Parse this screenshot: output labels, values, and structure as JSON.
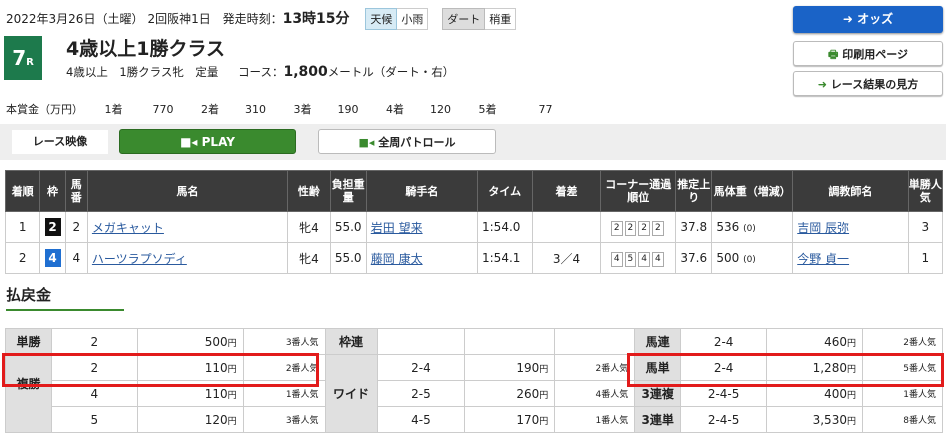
{
  "header": {
    "date": "2022年3月26日（土曜）",
    "meeting": "2回阪神1日",
    "post_time_label": "発走時刻：",
    "post_time": "13時15分",
    "weather_label": "天候",
    "weather_value": "小雨",
    "track_label": "ダート",
    "track_value": "稍重"
  },
  "race": {
    "number": "7",
    "number_suffix": "R",
    "title": "4歳以上1勝クラス",
    "conditions": "4歳以上　1勝クラス牝　定量",
    "course_label": "コース：",
    "distance": "1,800",
    "distance_suffix": "メートル（ダート・右）"
  },
  "buttons": {
    "odds": "オッズ",
    "print": "印刷用ページ",
    "guide": "レース結果の見方"
  },
  "prize": {
    "label": "本賞金（万円）",
    "items": [
      {
        "rank": "1着",
        "value": "770"
      },
      {
        "rank": "2着",
        "value": "310"
      },
      {
        "rank": "3着",
        "value": "190"
      },
      {
        "rank": "4着",
        "value": "120"
      },
      {
        "rank": "5着",
        "value": "77"
      }
    ]
  },
  "video": {
    "label": "レース映像",
    "play": "PLAY",
    "patrol": "全周パトロール"
  },
  "results": {
    "headers": [
      "着順",
      "枠",
      "馬番",
      "馬名",
      "性齢",
      "負担重量",
      "騎手名",
      "タイム",
      "着差",
      "コーナー通過順位",
      "推定上り",
      "馬体重（増減）",
      "調教師名",
      "単勝人気"
    ],
    "rows": [
      {
        "rank": "1",
        "waku": "2",
        "waku_color": "#111111",
        "umaban": "2",
        "horse": "メガキャット",
        "sex_age": "牝4",
        "weight": "55.0",
        "jockey": "岩田 望来",
        "time": "1:54.0",
        "margin": "",
        "corners": [
          "2",
          "2",
          "2",
          "2"
        ],
        "last3f": "37.8",
        "body_weight": "536",
        "body_diff": "(0)",
        "trainer": "吉岡 辰弥",
        "pop": "3"
      },
      {
        "rank": "2",
        "waku": "4",
        "waku_color": "#1f6fd1",
        "umaban": "4",
        "horse": "ハーツラプソディ",
        "sex_age": "牝4",
        "weight": "55.0",
        "jockey": "藤岡 康太",
        "time": "1:54.1",
        "margin": "3／4",
        "corners": [
          "4",
          "5",
          "4",
          "4"
        ],
        "last3f": "37.6",
        "body_weight": "500",
        "body_diff": "(0)",
        "trainer": "今野 貞一",
        "pop": "1"
      }
    ]
  },
  "payout": {
    "title": "払戻金",
    "yen": "円",
    "tansho": {
      "label": "単勝",
      "rows": [
        {
          "num": "2",
          "amount": "500",
          "pop": "3番人気"
        }
      ]
    },
    "fukusho": {
      "label": "複勝",
      "rows": [
        {
          "num": "2",
          "amount": "110",
          "pop": "2番人気"
        },
        {
          "num": "4",
          "amount": "110",
          "pop": "1番人気"
        },
        {
          "num": "5",
          "amount": "120",
          "pop": "3番人気"
        }
      ]
    },
    "wakuren": {
      "label": "枠連"
    },
    "wide": {
      "label": "ワイド",
      "rows": [
        {
          "num": "2-4",
          "amount": "190",
          "pop": "2番人気"
        },
        {
          "num": "2-5",
          "amount": "260",
          "pop": "4番人気"
        },
        {
          "num": "4-5",
          "amount": "170",
          "pop": "1番人気"
        }
      ]
    },
    "umaren": {
      "label": "馬連",
      "num": "2-4",
      "amount": "460",
      "pop": "2番人気"
    },
    "umatan": {
      "label": "馬単",
      "num": "2-4",
      "amount": "1,280",
      "pop": "5番人気"
    },
    "sanrenpuku": {
      "label": "3連複",
      "num": "2-4-5",
      "amount": "400",
      "pop": "1番人気"
    },
    "sanrentan": {
      "label": "3連単",
      "num": "2-4-5",
      "amount": "3,530",
      "pop": "8番人気"
    }
  }
}
